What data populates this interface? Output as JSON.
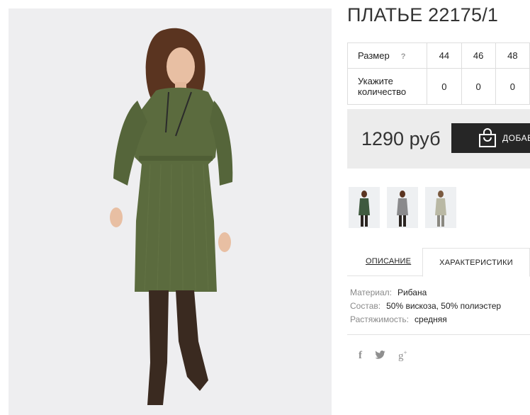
{
  "product": {
    "title": "ПЛАТЬЕ 22175/1",
    "price": "1290 руб",
    "buy_label": "ДОБАВ"
  },
  "size_table": {
    "size_label": "Размер",
    "help_icon_text": "?",
    "sizes": [
      "44",
      "46",
      "48"
    ],
    "qty_label_line1": "Укажите",
    "qty_label_line2": "количество",
    "quantities": [
      "0",
      "0",
      "0"
    ]
  },
  "thumbnails": [
    {
      "icon": "dress-thumbnail-green",
      "color": "#3f5a3f"
    },
    {
      "icon": "dress-thumbnail-grey",
      "color": "#8a8a8c"
    },
    {
      "icon": "dress-thumbnail-beige",
      "color": "#b9b8a4"
    }
  ],
  "tabs": [
    {
      "label": "ОПИСАНИЕ",
      "active": false
    },
    {
      "label": "ХАРАКТЕРИСТИКИ",
      "active": true
    }
  ],
  "characteristics": [
    {
      "key": "Материал:",
      "value": "Рибана"
    },
    {
      "key": "Состав:",
      "value": "50% вискоза, 50% полиэстер"
    },
    {
      "key": "Растяжимость:",
      "value": "средняя"
    }
  ],
  "social": {
    "facebook": "f",
    "twitter": "twitter-bird-icon",
    "googleplus": "g",
    "googleplus_sup": "+"
  },
  "colors": {
    "dress": "#5b6b3e",
    "boots": "#3a2a20",
    "buy_button": "#262626",
    "price_box": "#ececec"
  }
}
